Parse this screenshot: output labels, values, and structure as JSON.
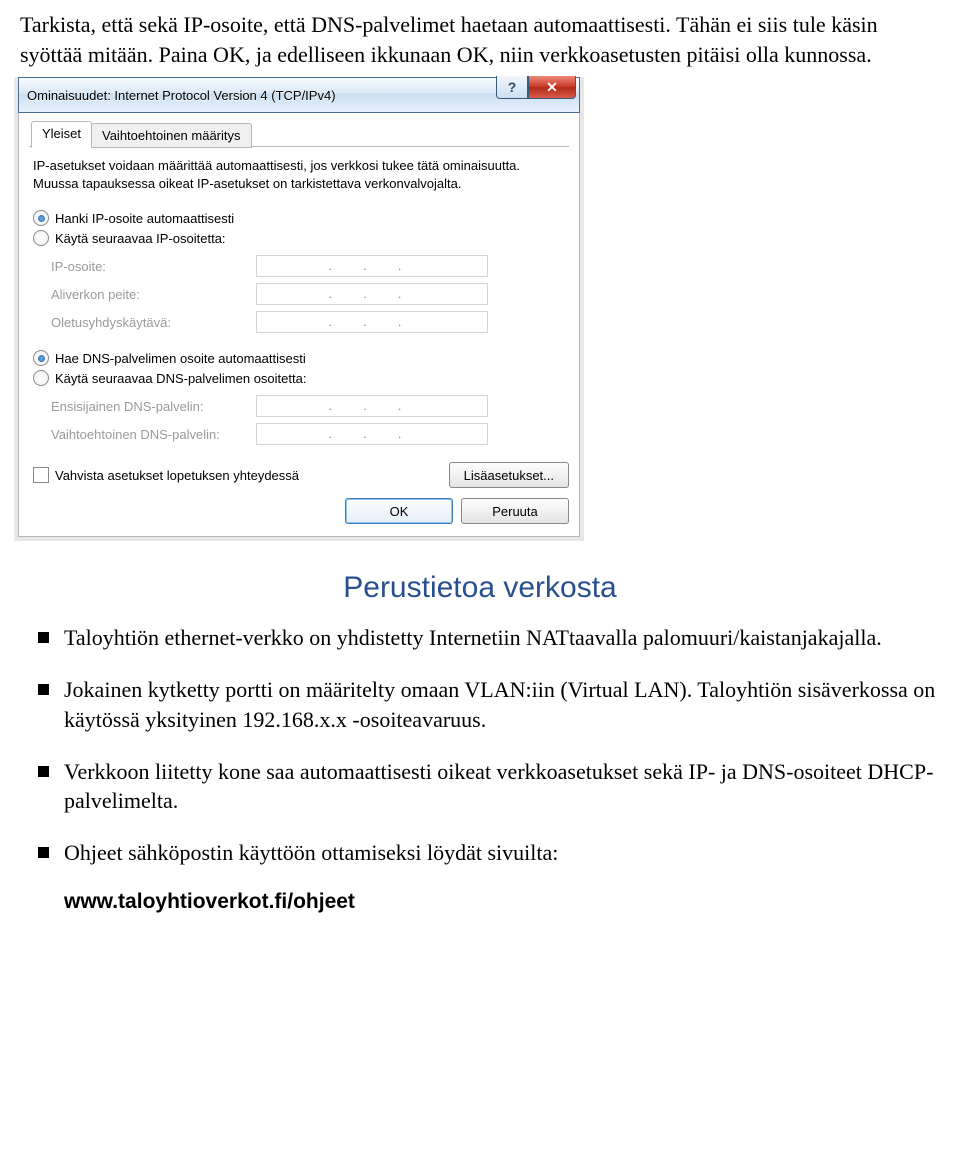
{
  "intro": {
    "p1": "Tarkista, että sekä IP-osoite, että DNS-palvelimet haetaan automaattisesti. Tähän ei siis tule käsin syöttää mitään. Paina OK, ja edelliseen ikkunaan OK, niin verkkoasetusten pitäisi olla kunnossa."
  },
  "dialog": {
    "title": "Ominaisuudet: Internet Protocol Version 4 (TCP/IPv4)",
    "help_glyph": "?",
    "close_glyph": "✕",
    "tabs": {
      "general": "Yleiset",
      "alternate": "Vaihtoehtoinen määritys"
    },
    "description": "IP-asetukset voidaan määrittää automaattisesti, jos verkkosi tukee tätä ominaisuutta. Muussa tapauksessa oikeat IP-asetukset on tarkistettava verkonvalvojalta.",
    "radio_ip_auto": "Hanki IP-osoite automaattisesti",
    "radio_ip_manual": "Käytä seuraavaa IP-osoitetta:",
    "ip_rows": {
      "ip": "IP-osoite:",
      "mask": "Aliverkon peite:",
      "gw": "Oletusyhdyskäytävä:"
    },
    "radio_dns_auto": "Hae DNS-palvelimen osoite automaattisesti",
    "radio_dns_manual": "Käytä seuraavaa DNS-palvelimen osoitetta:",
    "dns_rows": {
      "primary": "Ensisijainen DNS-palvelin:",
      "alt": "Vaihtoehtoinen DNS-palvelin:"
    },
    "ip_placeholder": ". . .",
    "validate": "Vahvista asetukset lopetuksen yhteydessä",
    "advanced": "Lisäasetukset...",
    "ok": "OK",
    "cancel": "Peruuta"
  },
  "article": {
    "heading": "Perustietoa verkosta",
    "b1": "Taloyhtiön ethernet-verkko on yhdistetty Internetiin NATtaavalla palomuuri/kaistanjakajalla.",
    "b2": "Jokainen kytketty portti on määritelty omaan VLAN:iin (Virtual LAN). Taloyhtiön sisäverkossa on käytössä yksityinen 192.168.x.x -osoiteavaruus.",
    "b3": "Verkkoon liitetty kone saa automaattisesti oikeat verkkoasetukset sekä IP- ja DNS-osoiteet DHCP-palvelimelta.",
    "b4": "Ohjeet sähköpostin käyttöön ottamiseksi löydät sivuilta:",
    "link": "www.taloyhtioverkot.fi/ohjeet"
  }
}
